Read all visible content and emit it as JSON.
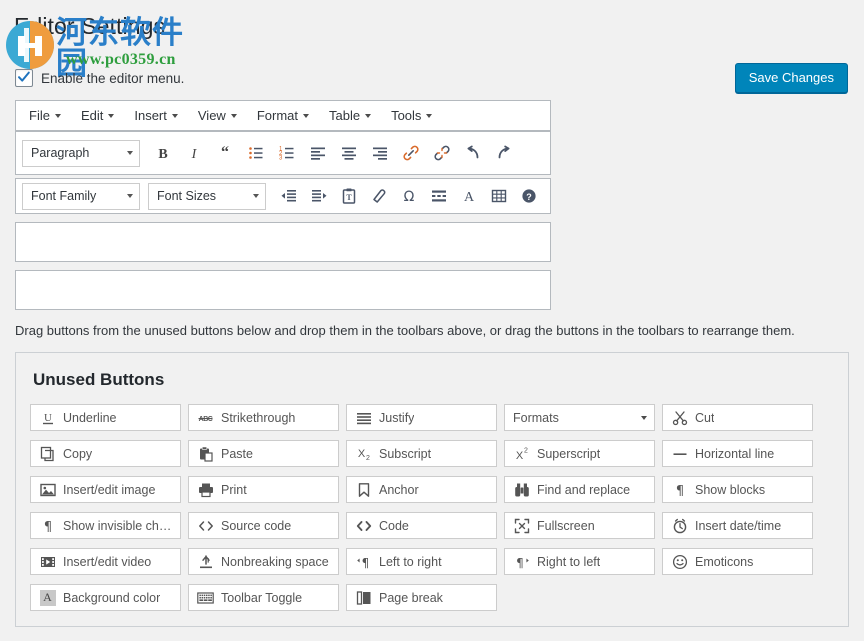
{
  "page": {
    "title": "Editor Settings",
    "enable_menu_label": "Enable the editor menu.",
    "save_label": "Save Changes",
    "drag_hint": "Drag buttons from the unused buttons below and drop them in the toolbars above, or drag the buttons in the toolbars to rearrange them.",
    "accent_color": "#0085ba"
  },
  "watermark": {
    "site_cn": "河东软件园",
    "site_url": "www.pc0359.cn",
    "blue": "#2a7fc9",
    "green": "#2e9e3e",
    "orange": "#eb9b42"
  },
  "menubar": {
    "items": [
      {
        "label": "File"
      },
      {
        "label": "Edit"
      },
      {
        "label": "Insert"
      },
      {
        "label": "View"
      },
      {
        "label": "Format"
      },
      {
        "label": "Table"
      },
      {
        "label": "Tools"
      }
    ]
  },
  "toolbar_row1": {
    "select": {
      "value": "Paragraph",
      "icon": "chevron-down-icon"
    },
    "buttons": [
      {
        "name": "bold",
        "icon": "bold-icon"
      },
      {
        "name": "italic",
        "icon": "italic-icon"
      },
      {
        "name": "blockquote",
        "icon": "blockquote-icon"
      },
      {
        "name": "bullist",
        "icon": "bullet-list-icon"
      },
      {
        "name": "numlist",
        "icon": "numbered-list-icon"
      },
      {
        "name": "alignleft",
        "icon": "align-left-icon"
      },
      {
        "name": "aligncenter",
        "icon": "align-center-icon"
      },
      {
        "name": "alignright",
        "icon": "align-right-icon"
      },
      {
        "name": "link",
        "icon": "link-icon"
      },
      {
        "name": "unlink",
        "icon": "unlink-icon"
      },
      {
        "name": "undo",
        "icon": "undo-icon"
      },
      {
        "name": "redo",
        "icon": "redo-icon"
      }
    ]
  },
  "toolbar_row2": {
    "font_family": {
      "value": "Font Family",
      "icon": "chevron-down-icon"
    },
    "font_sizes": {
      "value": "Font Sizes",
      "icon": "chevron-down-icon"
    },
    "buttons": [
      {
        "name": "outdent",
        "icon": "outdent-icon"
      },
      {
        "name": "indent",
        "icon": "indent-icon"
      },
      {
        "name": "paste-text",
        "icon": "paste-as-text-icon"
      },
      {
        "name": "remove-format",
        "icon": "eraser-icon"
      },
      {
        "name": "special-character",
        "icon": "omega-icon"
      },
      {
        "name": "read-more",
        "icon": "insert-more-icon"
      },
      {
        "name": "text-color",
        "icon": "text-color-icon"
      },
      {
        "name": "table",
        "icon": "table-icon"
      },
      {
        "name": "help",
        "icon": "help-icon"
      }
    ]
  },
  "empty_toolbars": [
    {
      "name": "toolbar-row-3"
    },
    {
      "name": "toolbar-row-4"
    }
  ],
  "unused_buttons": {
    "title": "Unused Buttons",
    "items": [
      {
        "label": "Underline",
        "icon": "underline-icon",
        "type": "button"
      },
      {
        "label": "Strikethrough",
        "icon": "strikethrough-icon",
        "type": "button"
      },
      {
        "label": "Justify",
        "icon": "align-justify-icon",
        "type": "button"
      },
      {
        "label": "Formats",
        "icon": "chevron-down-icon",
        "type": "select"
      },
      {
        "label": "Cut",
        "icon": "scissors-icon",
        "type": "button"
      },
      {
        "label": "Copy",
        "icon": "copy-icon",
        "type": "button"
      },
      {
        "label": "Paste",
        "icon": "clipboard-icon",
        "type": "button"
      },
      {
        "label": "Subscript",
        "icon": "subscript-icon",
        "type": "button"
      },
      {
        "label": "Superscript",
        "icon": "superscript-icon",
        "type": "button"
      },
      {
        "label": "Horizontal line",
        "icon": "horizontal-rule-icon",
        "type": "button"
      },
      {
        "label": "Insert/edit image",
        "icon": "image-icon",
        "type": "button"
      },
      {
        "label": "Print",
        "icon": "printer-icon",
        "type": "button"
      },
      {
        "label": "Anchor",
        "icon": "anchor-bookmark-icon",
        "type": "button"
      },
      {
        "label": "Find and replace",
        "icon": "binoculars-icon",
        "type": "button"
      },
      {
        "label": "Show blocks",
        "icon": "pilcrow-icon",
        "type": "button"
      },
      {
        "label": "Show invisible chara...",
        "icon": "pilcrow-icon",
        "type": "button"
      },
      {
        "label": "Source code",
        "icon": "angle-brackets-icon",
        "type": "button"
      },
      {
        "label": "Code",
        "icon": "angle-brackets-icon",
        "type": "button"
      },
      {
        "label": "Fullscreen",
        "icon": "fullscreen-icon",
        "type": "button"
      },
      {
        "label": "Insert date/time",
        "icon": "clock-icon",
        "type": "button"
      },
      {
        "label": "Insert/edit video",
        "icon": "film-icon",
        "type": "button"
      },
      {
        "label": "Nonbreaking space",
        "icon": "nonbreaking-space-icon",
        "type": "button"
      },
      {
        "label": "Left to right",
        "icon": "ltr-icon",
        "type": "button"
      },
      {
        "label": "Right to left",
        "icon": "rtl-icon",
        "type": "button"
      },
      {
        "label": "Emoticons",
        "icon": "smiley-icon",
        "type": "button"
      },
      {
        "label": "Background color",
        "icon": "background-color-icon",
        "type": "button"
      },
      {
        "label": "Toolbar Toggle",
        "icon": "keyboard-icon",
        "type": "button"
      },
      {
        "label": "Page break",
        "icon": "page-break-icon",
        "type": "button"
      }
    ]
  }
}
